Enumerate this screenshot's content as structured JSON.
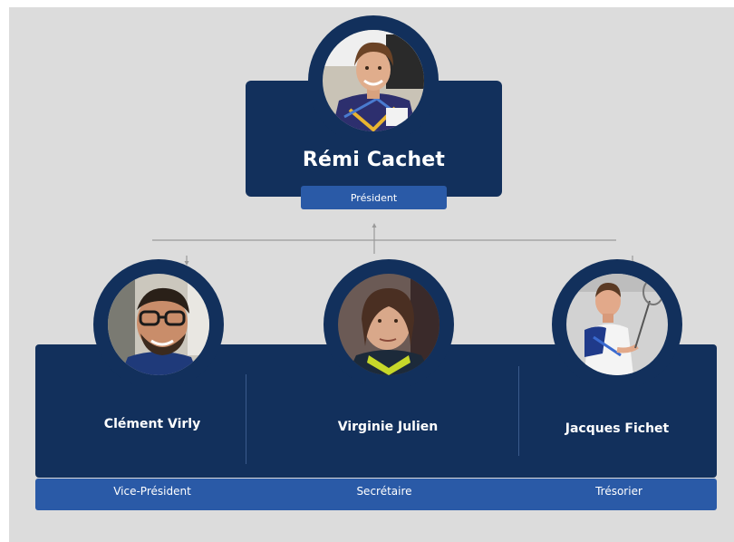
{
  "colors": {
    "navy": "#12305c",
    "role_band": "#2a5aa7",
    "background": "#dcdcdc",
    "connector": "#9a9a9a"
  },
  "president": {
    "name": "Rémi Cachet",
    "role": "Président"
  },
  "members": [
    {
      "name": "Clément Virly",
      "role": "Vice-Président"
    },
    {
      "name": "Virginie Julien",
      "role": "Secrétaire"
    },
    {
      "name": "Jacques Fichet",
      "role": "Trésorier"
    }
  ]
}
